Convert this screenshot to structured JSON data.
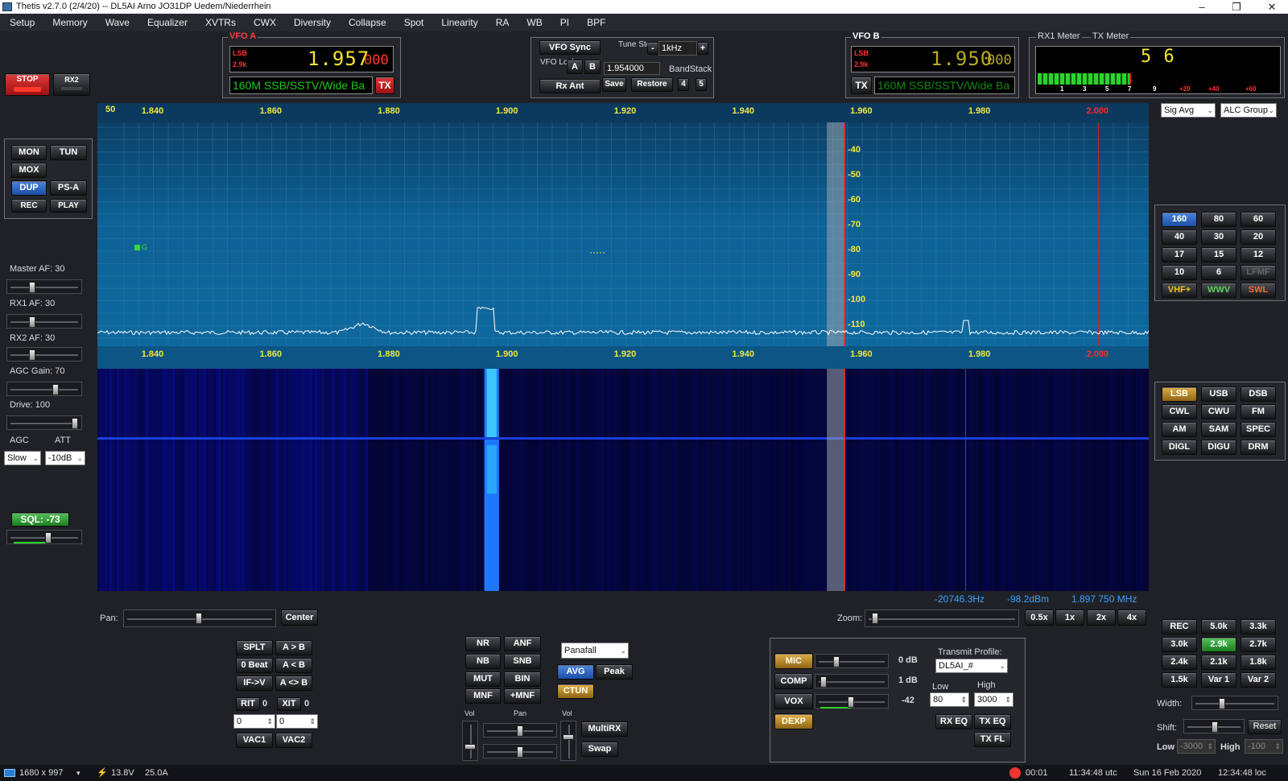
{
  "window": {
    "title": "Thetis v2.7.0 (2/4/20)  --  DL5AI  Arno  JO31DP  Uedem/Niederrhein",
    "min": "–",
    "max": "❐",
    "close": "✕"
  },
  "menu": [
    "Setup",
    "Memory",
    "Wave",
    "Equalizer",
    "XVTRs",
    "CWX",
    "Diversity",
    "Collapse",
    "Spot",
    "Linearity",
    "RA",
    "WB",
    "PI",
    "BPF"
  ],
  "power": {
    "stop": "STOP",
    "rx2": "RX2"
  },
  "vfoA": {
    "label": "VFO A",
    "mode": "LSB",
    "bw": "2.9k",
    "freq": "1.957",
    "sub": "000",
    "band": "160M SSB/SSTV/Wide Ba",
    "tx": "TX"
  },
  "vfoB": {
    "label": "VFO B",
    "mode": "LSB",
    "bw": "2.9k",
    "freq": "1.950",
    "sub": "000",
    "band": "160M SSB/SSTV/Wide Ba",
    "tx": "TX"
  },
  "vfoCenter": {
    "sync": "VFO Sync",
    "tune_step": "Tune Step:",
    "step_value": "1kHz",
    "minus": "-",
    "plus": "+",
    "vfo_lock": "VFO Lock:",
    "a": "A",
    "b": "B",
    "freq_input": "1.954000",
    "bandstack": "BandStack",
    "rx_ant": "Rx Ant",
    "save": "Save",
    "restore": "Restore",
    "bs4": "4",
    "bs5": "5"
  },
  "meter": {
    "rx1_label": "RX1 Meter",
    "tx_label": "TX Meter",
    "reading": "5 6",
    "scale": [
      "1",
      "3",
      "5",
      "7",
      "9",
      "+20",
      "+40",
      "+60"
    ],
    "rx_select": "Sig Avg",
    "tx_select": "ALC Group"
  },
  "leftControls": {
    "mon": "MON",
    "tun": "TUN",
    "mox": "MOX",
    "dup": "DUP",
    "psa": "PS-A",
    "rec": "REC",
    "play": "PLAY",
    "master_af": "Master AF:  30",
    "rx1_af": "RX1 AF:  30",
    "rx2_af": "RX2 AF:  30",
    "agc_gain": "AGC Gain:  70",
    "drive": "Drive:  100",
    "agc_label": "AGC",
    "att_label": "ATT",
    "agc_value": "Slow",
    "att_value": "-10dB",
    "sql": "SQL: -73"
  },
  "spectrum": {
    "ref_level": "50",
    "freq_ticks": [
      "1.840",
      "1.860",
      "1.880",
      "1.900",
      "1.920",
      "1.940",
      "1.960",
      "1.980",
      "2.000"
    ],
    "db_ticks": [
      "-40",
      "-50",
      "-60",
      "-70",
      "-80",
      "-90",
      "-100",
      "-110"
    ],
    "marker": "G",
    "readout_hz": "-20746.3Hz",
    "readout_dbm": "-98.2dBm",
    "readout_freq": "1.897 750 MHz"
  },
  "bands": [
    "160",
    "80",
    "60",
    "40",
    "30",
    "20",
    "17",
    "15",
    "12",
    "10",
    "6",
    "LFMF",
    "VHF+",
    "WWV",
    "SWL"
  ],
  "modes": [
    "LSB",
    "USB",
    "DSB",
    "CWL",
    "CWU",
    "FM",
    "AM",
    "SAM",
    "SPEC",
    "DIGL",
    "DIGU",
    "DRM"
  ],
  "pan": {
    "label": "Pan:",
    "center": "Center"
  },
  "zoom": {
    "label": "Zoom:",
    "z05": "0.5x",
    "z1": "1x",
    "z2": "2x",
    "z4": "4x"
  },
  "vfoOps": {
    "splt": "SPLT",
    "atob": "A > B",
    "zerobeat": "0 Beat",
    "btoa": "A < B",
    "ifv": "IF->V",
    "swapab": "A <> B",
    "rit": "RIT",
    "rit_val": "0",
    "xit": "XIT",
    "xit_val": "0",
    "rit_in": "0",
    "xit_in": "0",
    "vac1": "VAC1",
    "vac2": "VAC2"
  },
  "dsp": {
    "nr": "NR",
    "anf": "ANF",
    "nb": "NB",
    "snb": "SNB",
    "mut": "MUT",
    "bin": "BIN",
    "mnf": "MNF",
    "pmnf": "+MNF",
    "display": "Panafall",
    "avg": "AVG",
    "peak": "Peak",
    "ctun": "CTUN",
    "vol": "Vol",
    "pan": "Pan",
    "vol2": "Vol",
    "multirx": "MultiRX",
    "swap": "Swap"
  },
  "tx": {
    "mic": "MIC",
    "mic_val": "0 dB",
    "comp": "COMP",
    "comp_val": "1 dB",
    "vox": "VOX",
    "vox_val": "-42",
    "dexp": "DEXP",
    "profile_label": "Transmit Profile:",
    "profile": "DL5AI_#",
    "low_label": "Low",
    "high_label": "High",
    "low": "80",
    "high": "3000",
    "rxeq": "RX EQ",
    "txeq": "TX EQ",
    "txfl": "TX FL"
  },
  "filters": {
    "items": [
      "REC",
      "5.0k",
      "3.3k",
      "3.0k",
      "2.9k",
      "2.7k",
      "2.4k",
      "2.1k",
      "1.8k",
      "1.5k",
      "Var 1",
      "Var 2"
    ],
    "width": "Width:",
    "shift": "Shift:",
    "reset": "Reset",
    "low": "Low",
    "low_val": "-3000",
    "high": "High",
    "high_val": "-100"
  },
  "status": {
    "res": "1680 x 997",
    "volt": "13.8V",
    "amp": "25.0A",
    "timer": "00:01",
    "utc": "11:34:48 utc",
    "date": "Sun 16 Feb 2020",
    "loc": "12:34:48 loc"
  }
}
